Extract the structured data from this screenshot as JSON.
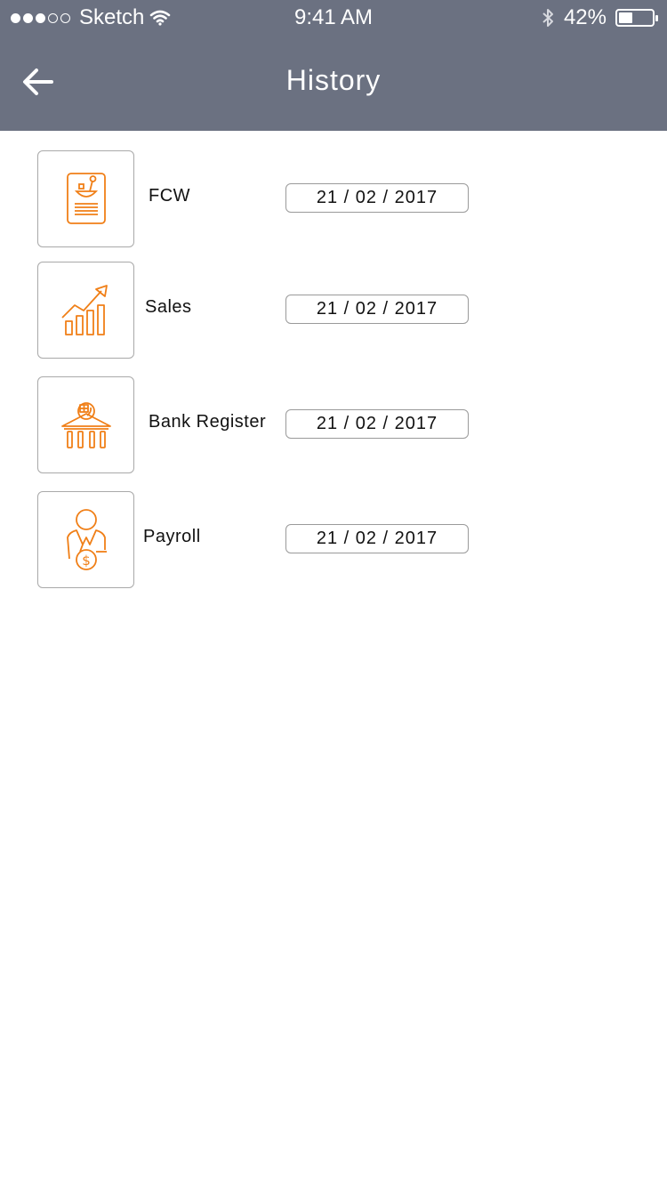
{
  "status_bar": {
    "carrier": "Sketch",
    "time": "9:41 AM",
    "battery": "42%",
    "battery_level": 0.42,
    "signal_dots_filled": 3,
    "signal_dots_total": 5
  },
  "header": {
    "title": "History",
    "back_icon": "arrow-left-icon"
  },
  "colors": {
    "header_bg": "#6b7181",
    "accent": "#f07f17"
  },
  "history": [
    {
      "label": "FCW",
      "date": "21 / 02 / 2017",
      "icon": "document-meal-icon"
    },
    {
      "label": "Sales",
      "date": "21 / 02 / 2017",
      "icon": "sales-growth-icon"
    },
    {
      "label": "Bank Register",
      "date": "21 / 02 / 2017",
      "icon": "bank-icon"
    },
    {
      "label": "Payroll",
      "date": "21 / 02 / 2017",
      "icon": "payroll-icon"
    }
  ]
}
